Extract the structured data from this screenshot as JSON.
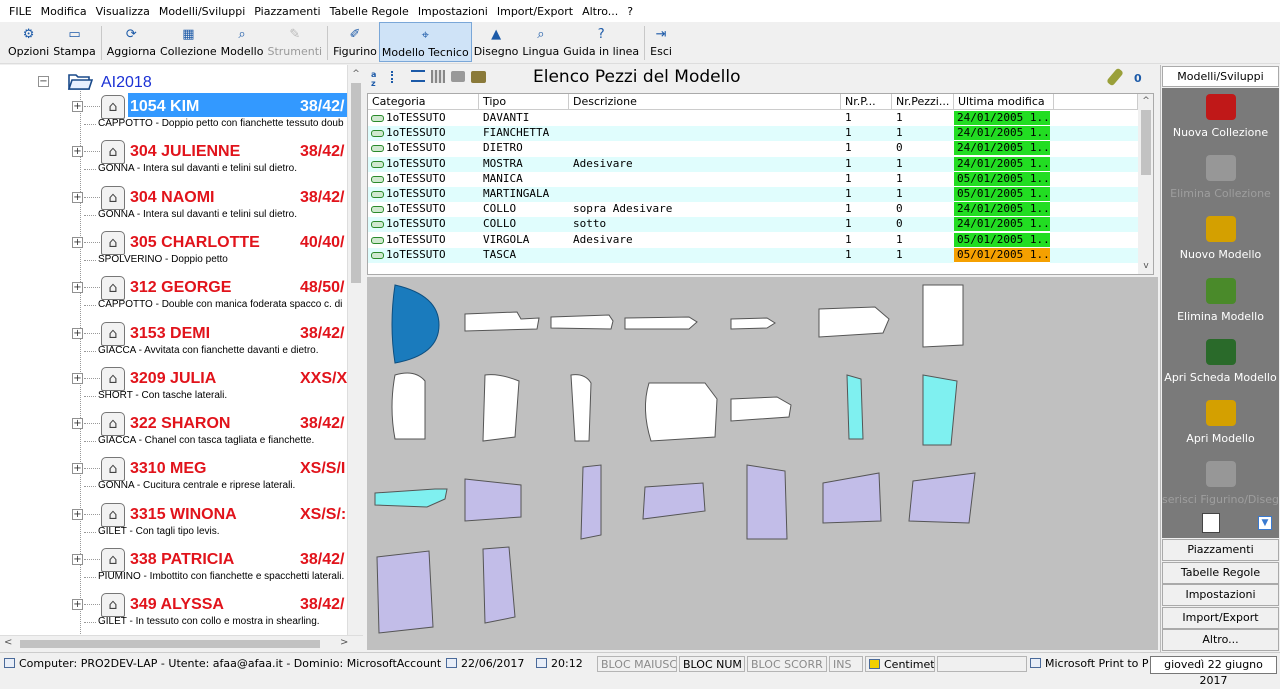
{
  "menu": [
    "FILE",
    "Modifica",
    "Visualizza",
    "Modelli/Sviluppi",
    "Piazzamenti",
    "Tabelle Regole",
    "Impostazioni",
    "Import/Export",
    "Altro...",
    "?"
  ],
  "toolbar": [
    {
      "label": "Opzioni",
      "icon": "options-icon",
      "enabled": true
    },
    {
      "label": "Stampa",
      "icon": "print-icon",
      "enabled": true
    },
    {
      "label": "Aggiorna",
      "icon": "refresh-icon",
      "enabled": true
    },
    {
      "label": "Collezione",
      "icon": "collection-icon",
      "enabled": true
    },
    {
      "label": "Modello",
      "icon": "search-model-icon",
      "enabled": true
    },
    {
      "label": "Strumenti",
      "icon": "tools-icon",
      "enabled": false
    },
    {
      "label": "Figurino",
      "icon": "pencil-icon",
      "enabled": true
    },
    {
      "label": "Modello Tecnico",
      "icon": "technical-model-icon",
      "enabled": true,
      "active": true
    },
    {
      "label": "Disegno",
      "icon": "shirt-icon",
      "enabled": true
    },
    {
      "label": "Lingua",
      "icon": "language-icon",
      "enabled": true
    },
    {
      "label": "Guida in linea",
      "icon": "help-icon",
      "enabled": true
    },
    {
      "label": "Esci",
      "icon": "exit-icon",
      "enabled": true
    }
  ],
  "tree": {
    "root": "AI2018",
    "items": [
      {
        "code": "1054 KIM",
        "sizes": "38/42/",
        "desc": "CAPPOTTO - Doppio petto con fianchette tessuto doub",
        "selected": true
      },
      {
        "code": "304 JULIENNE",
        "sizes": "38/42/",
        "desc": "GONNA - Intera sul davanti e telini sul dietro."
      },
      {
        "code": "304 NAOMI",
        "sizes": "38/42/",
        "desc": "GONNA - Intera sul davanti e telini sul dietro."
      },
      {
        "code": "305 CHARLOTTE",
        "sizes": "40/40/",
        "desc": "SPOLVERINO - Doppio petto"
      },
      {
        "code": "312 GEORGE",
        "sizes": "48/50/",
        "desc": "CAPPOTTO - Double con manica foderata spacco c. di"
      },
      {
        "code": "3153 DEMI",
        "sizes": "38/42/",
        "desc": "GIACCA - Avvitata con fianchette davanti e dietro."
      },
      {
        "code": "3209 JULIA",
        "sizes": "XXS/X",
        "desc": "SHORT - Con tasche laterali."
      },
      {
        "code": "322 SHARON",
        "sizes": "38/42/",
        "desc": "GIACCA - Chanel con tasca tagliata e fianchette."
      },
      {
        "code": "3310 MEG",
        "sizes": "XS/S/I",
        "desc": "GONNA - Cucitura centrale e riprese laterali."
      },
      {
        "code": "3315 WINONA",
        "sizes": "XS/S/:",
        "desc": "GILET - Con tagli tipo levis."
      },
      {
        "code": "338 PATRICIA",
        "sizes": "38/42/",
        "desc": "PIUMINO - Imbottito con fianchette e spacchetti laterali."
      },
      {
        "code": "349 ALYSSA",
        "sizes": "38/42/",
        "desc": "GILET - In tessuto con collo e mostra in shearling."
      }
    ]
  },
  "pieces": {
    "title": "Elenco Pezzi del Modello",
    "count": "0",
    "columns": [
      "Categoria",
      "Tipo",
      "Descrizione",
      "Nr.P...",
      "Nr.Pezzi...",
      "Ultima modifica"
    ],
    "rows": [
      {
        "categoria": "1oTESSUTO",
        "tipo": "DAVANTI",
        "descrizione": "",
        "nrp": "1",
        "nrpezzi": "1",
        "modifica": "24/01/2005 1...",
        "status": "green"
      },
      {
        "categoria": "1oTESSUTO",
        "tipo": "FIANCHETTA",
        "descrizione": "",
        "nrp": "1",
        "nrpezzi": "1",
        "modifica": "24/01/2005 1...",
        "status": "green"
      },
      {
        "categoria": "1oTESSUTO",
        "tipo": "DIETRO",
        "descrizione": "",
        "nrp": "1",
        "nrpezzi": "0",
        "modifica": "24/01/2005 1...",
        "status": "green"
      },
      {
        "categoria": "1oTESSUTO",
        "tipo": "MOSTRA",
        "descrizione": "Adesivare",
        "nrp": "1",
        "nrpezzi": "1",
        "modifica": "24/01/2005 1...",
        "status": "green"
      },
      {
        "categoria": "1oTESSUTO",
        "tipo": "MANICA",
        "descrizione": "",
        "nrp": "1",
        "nrpezzi": "1",
        "modifica": "05/01/2005 1...",
        "status": "green"
      },
      {
        "categoria": "1oTESSUTO",
        "tipo": "MARTINGALA",
        "descrizione": "",
        "nrp": "1",
        "nrpezzi": "1",
        "modifica": "05/01/2005 1...",
        "status": "green"
      },
      {
        "categoria": "1oTESSUTO",
        "tipo": "COLLO",
        "descrizione": "sopra Adesivare",
        "nrp": "1",
        "nrpezzi": "0",
        "modifica": "24/01/2005 1...",
        "status": "green"
      },
      {
        "categoria": "1oTESSUTO",
        "tipo": "COLLO",
        "descrizione": "sotto",
        "nrp": "1",
        "nrpezzi": "0",
        "modifica": "24/01/2005 1...",
        "status": "green"
      },
      {
        "categoria": "1oTESSUTO",
        "tipo": "VIRGOLA",
        "descrizione": "Adesivare",
        "nrp": "1",
        "nrpezzi": "1",
        "modifica": "05/01/2005 1...",
        "status": "green"
      },
      {
        "categoria": "1oTESSUTO",
        "tipo": "TASCA",
        "descrizione": "",
        "nrp": "1",
        "nrpezzi": "1",
        "modifica": "05/01/2005 1...",
        "status": "orange"
      }
    ]
  },
  "sidebar": {
    "header": "Modelli/Sviluppi",
    "actions": [
      {
        "label": "Nuova Collezione",
        "enabled": true
      },
      {
        "label": "Elimina Collezione",
        "enabled": false
      },
      {
        "label": "Nuovo Modello",
        "enabled": true
      },
      {
        "label": "Elimina Modello",
        "enabled": true
      },
      {
        "label": "Apri Scheda Modello",
        "enabled": true
      },
      {
        "label": "Apri Modello",
        "enabled": true
      },
      {
        "label": "serisci Figurino/Disegn",
        "enabled": false
      }
    ],
    "sections": [
      "Piazzamenti",
      "Tabelle Regole",
      "Impostazioni",
      "Import/Export",
      "Altro..."
    ]
  },
  "status": {
    "info": "Computer: PRO2DEV-LAP - Utente: afaa@afaa.it - Dominio: MicrosoftAccount",
    "date": "22/06/2017",
    "time": "20:12",
    "caps": "BLOC MAIUSC",
    "num": "BLOC NUM",
    "scroll": "BLOC SCORR",
    "ins": "INS",
    "unit": "Centimet",
    "printer": "Microsoft Print to P",
    "tooltip": "giovedì 22 giugno 2017"
  },
  "colors": {
    "selection": "#3399ff",
    "model_name": "#e1131b",
    "date_ok": "#22dd22",
    "date_warn": "#f5a000",
    "alt_row": "#e0fdfd",
    "piece_blue": "#1a7bbd",
    "piece_cyan": "#7ff0f0",
    "piece_lavender": "#c2bde8"
  }
}
